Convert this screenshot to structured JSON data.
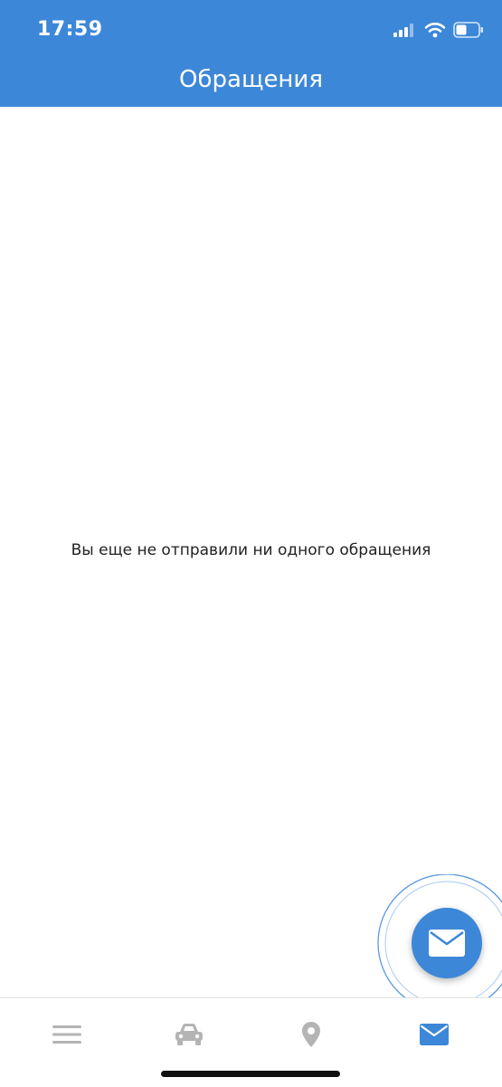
{
  "colors": {
    "accent": "#3d87d8",
    "tab_inactive": "#b4b4b4",
    "tab_active": "#3d87d8"
  },
  "status_bar": {
    "time": "17:59",
    "icons": [
      "cellular-signal-icon",
      "wifi-icon",
      "battery-icon"
    ]
  },
  "header": {
    "title": "Обращения"
  },
  "main": {
    "empty_message": "Вы еще не отправили ни одного обращения"
  },
  "fab": {
    "icon": "envelope-icon"
  },
  "tab_bar": {
    "items": [
      {
        "name": "menu",
        "icon": "menu-icon",
        "active": false
      },
      {
        "name": "car",
        "icon": "car-icon",
        "active": false
      },
      {
        "name": "location",
        "icon": "location-pin-icon",
        "active": false
      },
      {
        "name": "messages",
        "icon": "envelope-icon",
        "active": true
      }
    ]
  }
}
